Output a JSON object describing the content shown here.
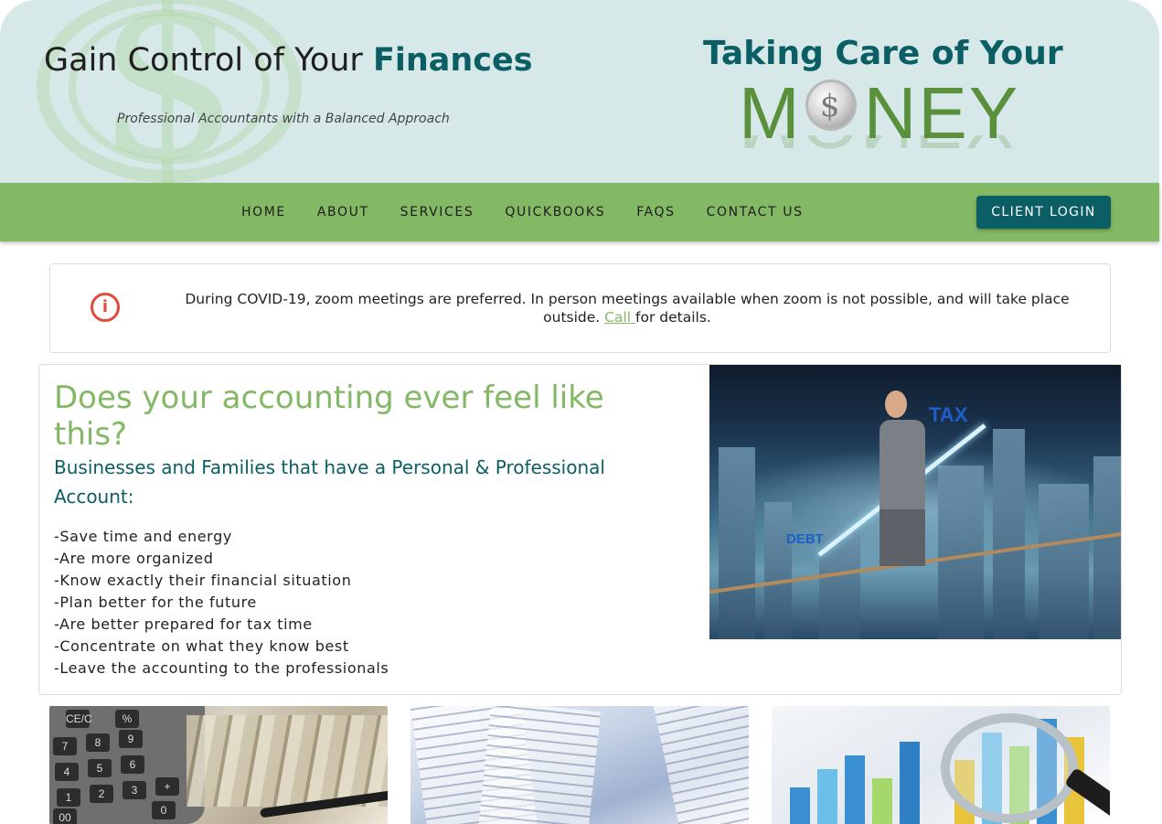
{
  "header": {
    "title_prefix": "Gain Control of Your ",
    "title_emphasis": "Finances",
    "tagline": "Professional Accountants with a Balanced Approach",
    "logo_heading": "Taking Care of Your",
    "logo_word_start": "M",
    "logo_coin_symbol": "$",
    "logo_word_end": "NEY",
    "logo_reflection": "MONEY"
  },
  "nav": {
    "items": [
      {
        "label": "HOME"
      },
      {
        "label": "ABOUT"
      },
      {
        "label": "SERVICES"
      },
      {
        "label": "QUICKBOOKS"
      },
      {
        "label": "FAQS"
      },
      {
        "label": "CONTACT US"
      }
    ],
    "login_label": "CLIENT LOGIN"
  },
  "notice": {
    "icon": "info-circle-icon",
    "text_before": "During COVID-19, zoom meetings are preferred. In person meetings available when zoom is not possible, and will take place outside. ",
    "link_text": "Call ",
    "text_after": "for details."
  },
  "main": {
    "heading": "Does your accounting ever feel like this?",
    "subheading": "Businesses and Families that have a Personal & Professional Account:",
    "benefits": [
      "-Save time and energy",
      "-Are more organized",
      "-Know exactly their financial situation",
      "-Plan better for the future",
      "-Are better prepared for tax time",
      "-Concentrate on what they know best",
      "-Leave the accounting to the professionals"
    ],
    "image": {
      "tag_tax": "TAX",
      "tag_debt": "DEBT"
    }
  },
  "thumbnails": {
    "calculator_keys": [
      "CE/C",
      "%",
      "7",
      "8",
      "9",
      "4",
      "5",
      "6",
      "1",
      "2",
      "3",
      "+",
      "00",
      "0"
    ]
  },
  "colors": {
    "header_bg": "#d6e8e8",
    "nav_bg": "#83b865",
    "brand_teal": "#0b5e63",
    "accent_green": "#83b865",
    "alert_red": "#e04b3c"
  }
}
